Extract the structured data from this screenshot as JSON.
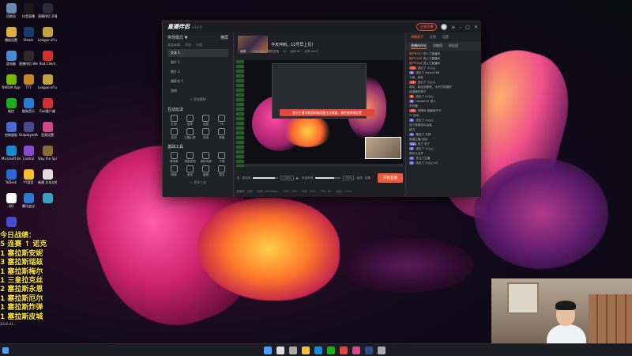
{
  "desktop_icons": [
    {
      "label": "回收站",
      "icon": "recycle-bin-icon",
      "color": "#6a8ab0"
    },
    {
      "label": "抖音直播",
      "icon": "douyin-live-icon",
      "color": "#1a1a1a"
    },
    {
      "label": "直播伴侣 开播",
      "icon": "live-companion-icon",
      "color": "#2a2a3a"
    },
    {
      "label": "播放设置",
      "icon": "folder-icon",
      "color": "#e0b040"
    },
    {
      "label": "Steam",
      "icon": "steam-icon",
      "color": "#1a3a6a"
    },
    {
      "label": "League of Legends",
      "icon": "lol-icon",
      "color": "#c0a040"
    },
    {
      "label": "此电脑",
      "icon": "pc-icon",
      "color": "#4a8ad0"
    },
    {
      "label": "直播伴侣 WeGame",
      "icon": "wegame-icon",
      "color": "#2a2a2a"
    },
    {
      "label": "Riot Client",
      "icon": "riot-icon",
      "color": "#d03030"
    },
    {
      "label": "NVIDIA App",
      "icon": "nvidia-icon",
      "color": "#76b900"
    },
    {
      "label": "TFT",
      "icon": "tft-icon",
      "color": "#c08a2a"
    },
    {
      "label": "League of Legends",
      "icon": "lol-icon",
      "color": "#c0a040"
    },
    {
      "label": "微信",
      "icon": "wechat-icon",
      "color": "#1aad19"
    },
    {
      "label": "酷狗音乐",
      "icon": "kugou-icon",
      "color": "#2a7ad0"
    },
    {
      "label": "Riot客户端",
      "icon": "riot-icon",
      "color": "#d03030"
    },
    {
      "label": "控制面板",
      "icon": "control-panel-icon",
      "color": "#4a6ad0"
    },
    {
      "label": "OutplayedAuto",
      "icon": "outplayed-icon",
      "color": "#4a4a8a"
    },
    {
      "label": "音频设置",
      "icon": "audio-icon",
      "color": "#d04a8a"
    },
    {
      "label": "Microsoft Edge",
      "icon": "edge-icon",
      "color": "#1a8ad0"
    },
    {
      "label": "Control",
      "icon": "control-icon",
      "color": "#8a4ad0"
    },
    {
      "label": "Slay the Spire 2",
      "icon": "spire-icon",
      "color": "#8a6a3a"
    },
    {
      "label": "ToDesk",
      "icon": "todesk-icon",
      "color": "#2a6ad0"
    },
    {
      "label": "YY语音",
      "icon": "yy-icon",
      "color": "#f0c030"
    },
    {
      "label": "新建 文本文档.txt",
      "icon": "text-file-icon",
      "color": "#dddddd"
    },
    {
      "label": "QQ",
      "icon": "qq-icon",
      "color": "#ffffff"
    },
    {
      "label": "腾讯会议",
      "icon": "meeting-icon",
      "color": "#2a7ad0"
    },
    {
      "label": "",
      "icon": "app-icon",
      "color": "#3aa0c0"
    },
    {
      "label": "",
      "icon": "app-icon",
      "color": "#4a4ad0"
    }
  ],
  "overlay": {
    "title": "今日战绩：",
    "lines": [
      "5 连赛 ↑ 诺克",
      "1 塞拉斯安妮",
      "3 塞拉斯瑞兹",
      "1 塞拉斯梅尔",
      "1 三皇拉克丝",
      "2 塞拉斯永恩",
      "1 塞拉斯厄尔",
      "1 塞拉斯炸弹",
      "1 塞拉斯皮城"
    ],
    "footer": "2026-01..."
  },
  "app": {
    "logo": "直播伴侣",
    "version": "v3.4.0",
    "titlebar_badge": "立即开播",
    "left": {
      "mode": "常规模式 ▼",
      "mode_right": "横屏",
      "tabs": [
        "画面来源",
        "添加",
        "分组"
      ],
      "scenes": [
        "文本 1",
        "图片 1",
        "图片 2",
        "捕获名 1",
        "游戏"
      ],
      "add_scene": "+ 添加素材",
      "interaction_title": "互动玩法",
      "interaction_tools": [
        "礼物",
        "投票",
        "抽奖",
        "PK",
        "连线",
        "主播心愿",
        "音浪",
        "弹幕"
      ],
      "basic_title": "基础工具",
      "basic_tools": [
        "清晰度",
        "美颜滤镜",
        "虚拟背景",
        "下载",
        "降噪",
        "音效",
        "截图",
        "更多"
      ],
      "more": "— 更多工具"
    },
    "center": {
      "room_title": "今天冲刺，11号早上见！",
      "sub_tags": [
        "编辑",
        "直播设置"
      ],
      "sub_info": [
        "横屏直播",
        "2K",
        "帧率 60",
        "码率 6000"
      ],
      "notice": "部分主播可能因网络问题无法观看，请检查网络设置",
      "mic_label": "麦克风",
      "mic_pct": "120%",
      "system_label": "系统声音",
      "system_pct": "93%",
      "btn_labels": [
        "画质",
        "设置"
      ],
      "start_button": "开始直播",
      "status": [
        "直播间：正常",
        "码率：6000kbps",
        "CPU：15%",
        "内存：32%",
        "FPS：60",
        "延迟：12ms"
      ]
    },
    "right": {
      "tabs": [
        "弹幕助手",
        "礼物",
        "设置"
      ],
      "sub_tabs": [
        "直播间评论",
        "贡献榜",
        "粉丝团"
      ],
      "messages": [
        {
          "badge": "",
          "user": "用户8927",
          "text": "进入了直播间"
        },
        {
          "badge": "",
          "user": "用户1165",
          "text": "进入了直播间"
        },
        {
          "badge": "",
          "user": "用户3310",
          "text": "进入了直播间"
        },
        {
          "badge": "17",
          "user": "",
          "text": "送出了 小心心"
        },
        {
          "badge": "6",
          "user": "",
          "text": "送出了 Ashe2788"
        },
        {
          "badge": "",
          "user": "",
          "text": "人呢，我在"
        },
        {
          "badge": "11",
          "user": "",
          "text": "送出了 小心心"
        },
        {
          "badge": "",
          "user": "",
          "text": "哈哈，我还没看呢，今天打的挺好"
        },
        {
          "badge": "",
          "user": "",
          "text": "这波操作秀了"
        },
        {
          "badge": "8",
          "user": "",
          "text": "送出了 小心心"
        },
        {
          "badge": "4",
          "user": "",
          "text": "Hacker01 进入"
        },
        {
          "badge": "",
          "user": "",
          "text": "不开播"
        },
        {
          "badge": "19",
          "user": "",
          "text": "说得对 直播间不卡"
        },
        {
          "badge": "",
          "user": "",
          "text": "?? 在吗"
        },
        {
          "badge": "5",
          "user": "",
          "text": "送出了 小心心"
        },
        {
          "badge": "",
          "user": "",
          "text": "这个英雄怎么出装"
        },
        {
          "badge": "",
          "user": "",
          "text": "给力"
        },
        {
          "badge": "9",
          "user": "",
          "text": "赠送了 礼物"
        },
        {
          "badge": "",
          "user": "",
          "text": "谢谢主播 加油"
        },
        {
          "badge": "12",
          "user": "",
          "text": "来了 来了"
        },
        {
          "badge": "3",
          "user": "",
          "text": "送出了 小心心"
        },
        {
          "badge": "",
          "user": "",
          "text": "明天几点开"
        },
        {
          "badge": "7",
          "user": "",
          "text": "关注了主播"
        },
        {
          "badge": "2",
          "user": "",
          "text": "送出了 小心心 x2"
        }
      ]
    }
  },
  "taskbar_apps": [
    {
      "icon": "start-icon",
      "color": "#4aa0ff"
    },
    {
      "icon": "search-icon",
      "color": "#dddddd"
    },
    {
      "icon": "task-view-icon",
      "color": "#aaaaaa"
    },
    {
      "icon": "file-explorer-icon",
      "color": "#f0c040"
    },
    {
      "icon": "edge-icon",
      "color": "#1a8ad0"
    },
    {
      "icon": "wechat-icon",
      "color": "#1aad19"
    },
    {
      "icon": "live-icon",
      "color": "#e0483a"
    },
    {
      "icon": "app-icon",
      "color": "#d04a8a"
    },
    {
      "icon": "steam-icon",
      "color": "#2a4a8a"
    },
    {
      "icon": "app-icon",
      "color": "#aaaaaa"
    }
  ]
}
